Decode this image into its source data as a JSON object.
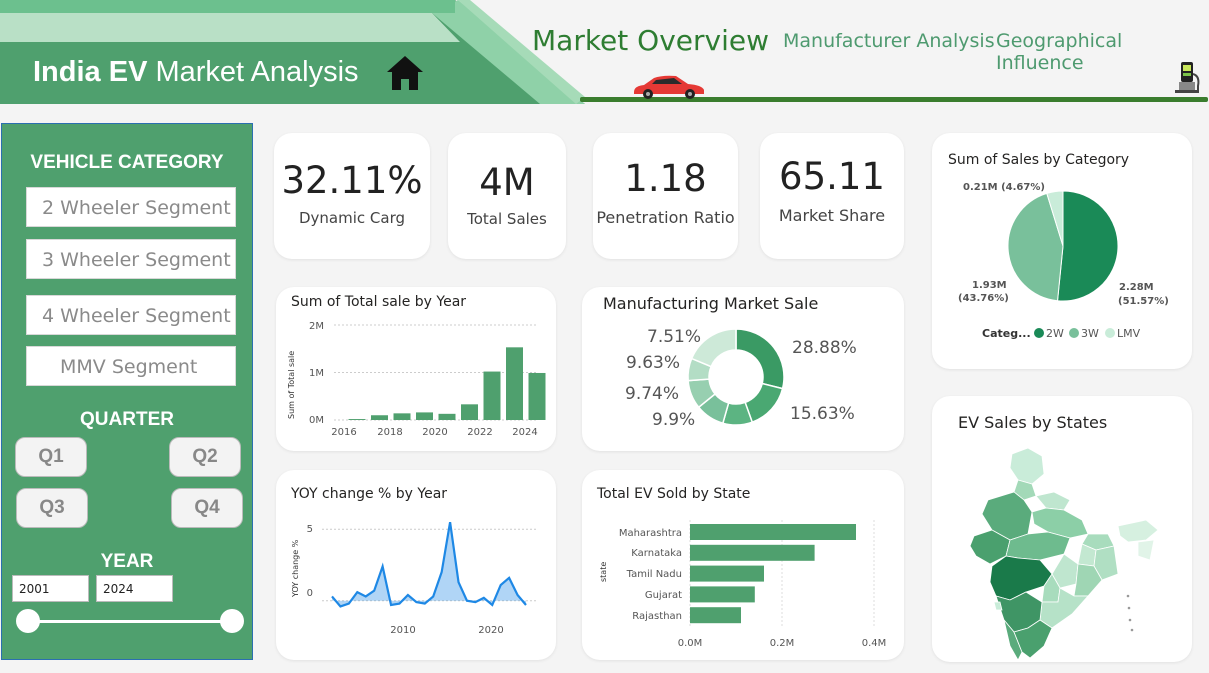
{
  "header": {
    "title_bold": "India EV",
    "title_rest": "Market  Analysis",
    "nav": [
      {
        "label": "Market Overview",
        "active": true
      },
      {
        "label": "Manufacturer Analysis",
        "active": false
      },
      {
        "label": "Geographical Influence",
        "active": false
      }
    ]
  },
  "sidebar": {
    "vehicle_category_label": "VEHICLE CATEGORY",
    "segments": [
      "2 Wheeler Segment",
      "3 Wheeler Segment",
      "4 Wheeler Segment",
      "MMV Segment"
    ],
    "quarter_label": "QUARTER",
    "quarters": [
      "Q1",
      "Q2",
      "Q3",
      "Q4"
    ],
    "year_label": "YEAR",
    "year_from": "2001",
    "year_to": "2024"
  },
  "kpis": [
    {
      "value": "32.11%",
      "label": "Dynamic Carg"
    },
    {
      "value": "4M",
      "label": "Total Sales"
    },
    {
      "value": "1.18",
      "label": "Penetration Ratio"
    },
    {
      "value": "65.11",
      "label": "Market Share"
    }
  ],
  "colors": {
    "accent": "#4fa06e",
    "dark_green": "#1a8a57",
    "mid_green": "#79c09b",
    "light_green": "#c9ecd9",
    "line_blue": "#1e88e5"
  },
  "charts": {
    "sales_by_year": {
      "title": "Sum of Total sale by Year",
      "ylabel": "Sum of Total sale",
      "yticks": [
        "2M",
        "1M",
        "0M"
      ],
      "xticks": [
        "2016",
        "2018",
        "2020",
        "2022",
        "2024"
      ]
    },
    "mfg_market": {
      "title": "Manufacturing Market Sale",
      "labels": [
        "28.88%",
        "15.63%",
        "9.9%",
        "9.74%",
        "9.63%",
        "7.51%"
      ]
    },
    "category_pie": {
      "title": "Sum of Sales by Category",
      "labels": [
        "0.21M (4.67%)",
        "1.93M",
        "(43.76%)",
        "2.28M",
        "(51.57%)"
      ],
      "legend_title": "Categ...",
      "legend": [
        "2W",
        "3W",
        "LMV"
      ]
    },
    "yoy": {
      "title": "YOY change % by Year",
      "ylabel": "YOY change %",
      "yticks": [
        "5",
        "0"
      ],
      "xticks": [
        "2010",
        "2020"
      ]
    },
    "ev_by_state": {
      "title": "Total EV Sold by State",
      "ylabel": "state",
      "categories": [
        "Maharashtra",
        "Karnataka",
        "Tamil Nadu",
        "Gujarat",
        "Rajasthan"
      ],
      "xticks": [
        "0.0M",
        "0.2M",
        "0.4M"
      ]
    },
    "map": {
      "title": "EV Sales by States"
    }
  },
  "chart_data": [
    {
      "type": "bar",
      "title": "Sum of Total sale by Year",
      "xlabel": "",
      "ylabel": "Sum of Total sale",
      "categories": [
        "2016",
        "2017",
        "2018",
        "2019",
        "2020",
        "2021",
        "2022",
        "2023",
        "2024"
      ],
      "values": [
        0.02,
        0.1,
        0.14,
        0.16,
        0.13,
        0.33,
        1.02,
        1.53,
        0.99
      ],
      "unit": "M",
      "ylim": [
        0,
        2
      ]
    },
    {
      "type": "pie",
      "title": "Manufacturing Market Sale",
      "values": [
        28.88,
        15.63,
        9.9,
        9.74,
        9.63,
        7.51,
        18.71
      ],
      "donut": true
    },
    {
      "type": "pie",
      "title": "Sum of Sales by Category",
      "categories": [
        "2W",
        "3W",
        "LMV"
      ],
      "values": [
        2.28,
        1.93,
        0.21
      ],
      "percents": [
        51.57,
        43.76,
        4.67
      ]
    },
    {
      "type": "area",
      "title": "YOY change % by Year",
      "ylabel": "YOY change %",
      "x": [
        2001,
        2002,
        2003,
        2004,
        2005,
        2006,
        2007,
        2008,
        2009,
        2010,
        2011,
        2012,
        2013,
        2014,
        2015,
        2016,
        2017,
        2018,
        2019,
        2020,
        2021,
        2022,
        2023,
        2024
      ],
      "values": [
        0.3,
        -0.4,
        -0.2,
        0.6,
        0.3,
        0.7,
        2.4,
        -0.3,
        -0.2,
        0.4,
        -0.1,
        -0.2,
        0.3,
        2.0,
        5.5,
        1.3,
        0.0,
        -0.1,
        0.2,
        -0.3,
        1.1,
        1.6,
        0.4,
        -0.3
      ],
      "ylim": [
        -1,
        6
      ]
    },
    {
      "type": "bar",
      "orientation": "horizontal",
      "title": "Total EV Sold by State",
      "ylabel": "state",
      "categories": [
        "Maharashtra",
        "Karnataka",
        "Tamil Nadu",
        "Gujarat",
        "Rajasthan"
      ],
      "values": [
        0.4,
        0.31,
        0.2,
        0.18,
        0.15
      ],
      "unit": "M",
      "xlim": [
        0,
        0.4
      ]
    }
  ]
}
